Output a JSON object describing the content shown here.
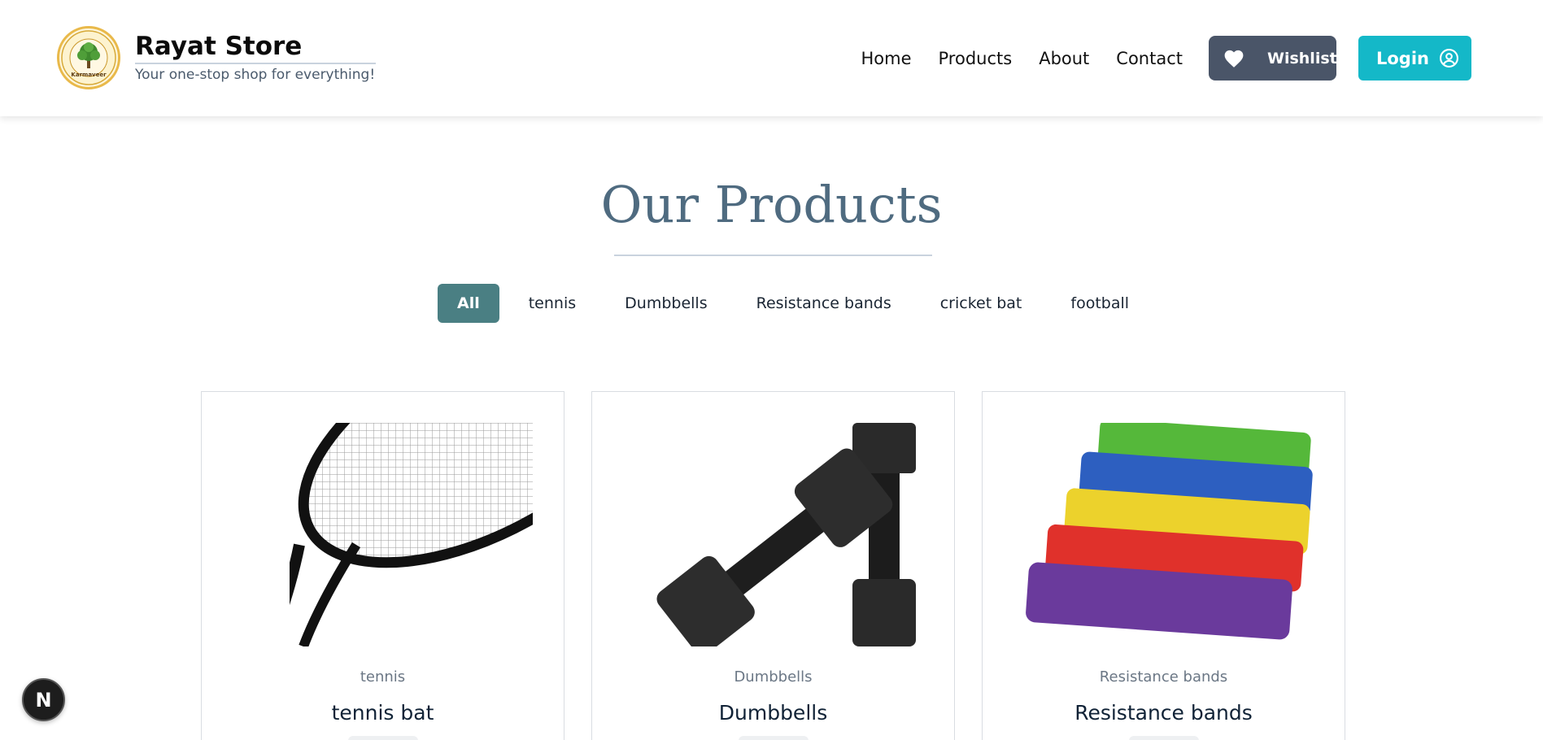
{
  "header": {
    "brand_title": "Rayat Store",
    "brand_subtitle": "Your one-stop shop for everything!",
    "logo_caption": "Karmaveer",
    "nav": [
      {
        "label": "Home"
      },
      {
        "label": "Products"
      },
      {
        "label": "About"
      },
      {
        "label": "Contact"
      }
    ],
    "wishlist_label": "Wishlist",
    "login_label": "Login"
  },
  "main": {
    "title": "Our Products",
    "filters": [
      {
        "label": "All",
        "active": true
      },
      {
        "label": "tennis",
        "active": false
      },
      {
        "label": "Dumbbells",
        "active": false
      },
      {
        "label": "Resistance bands",
        "active": false
      },
      {
        "label": "cricket bat",
        "active": false
      },
      {
        "label": "football",
        "active": false
      }
    ],
    "products": [
      {
        "category": "tennis",
        "name": "tennis bat",
        "image": "tennis-racket"
      },
      {
        "category": "Dumbbells",
        "name": "Dumbbells",
        "image": "dumbbells"
      },
      {
        "category": "Resistance bands",
        "name": "Resistance bands",
        "image": "resistance-bands"
      }
    ]
  },
  "fab": {
    "label": "N"
  },
  "colors": {
    "accent_teal": "#14b8c8",
    "wishlist_bg": "#4a5568",
    "filter_active": "#4a7f83",
    "title": "#4f6b80"
  }
}
